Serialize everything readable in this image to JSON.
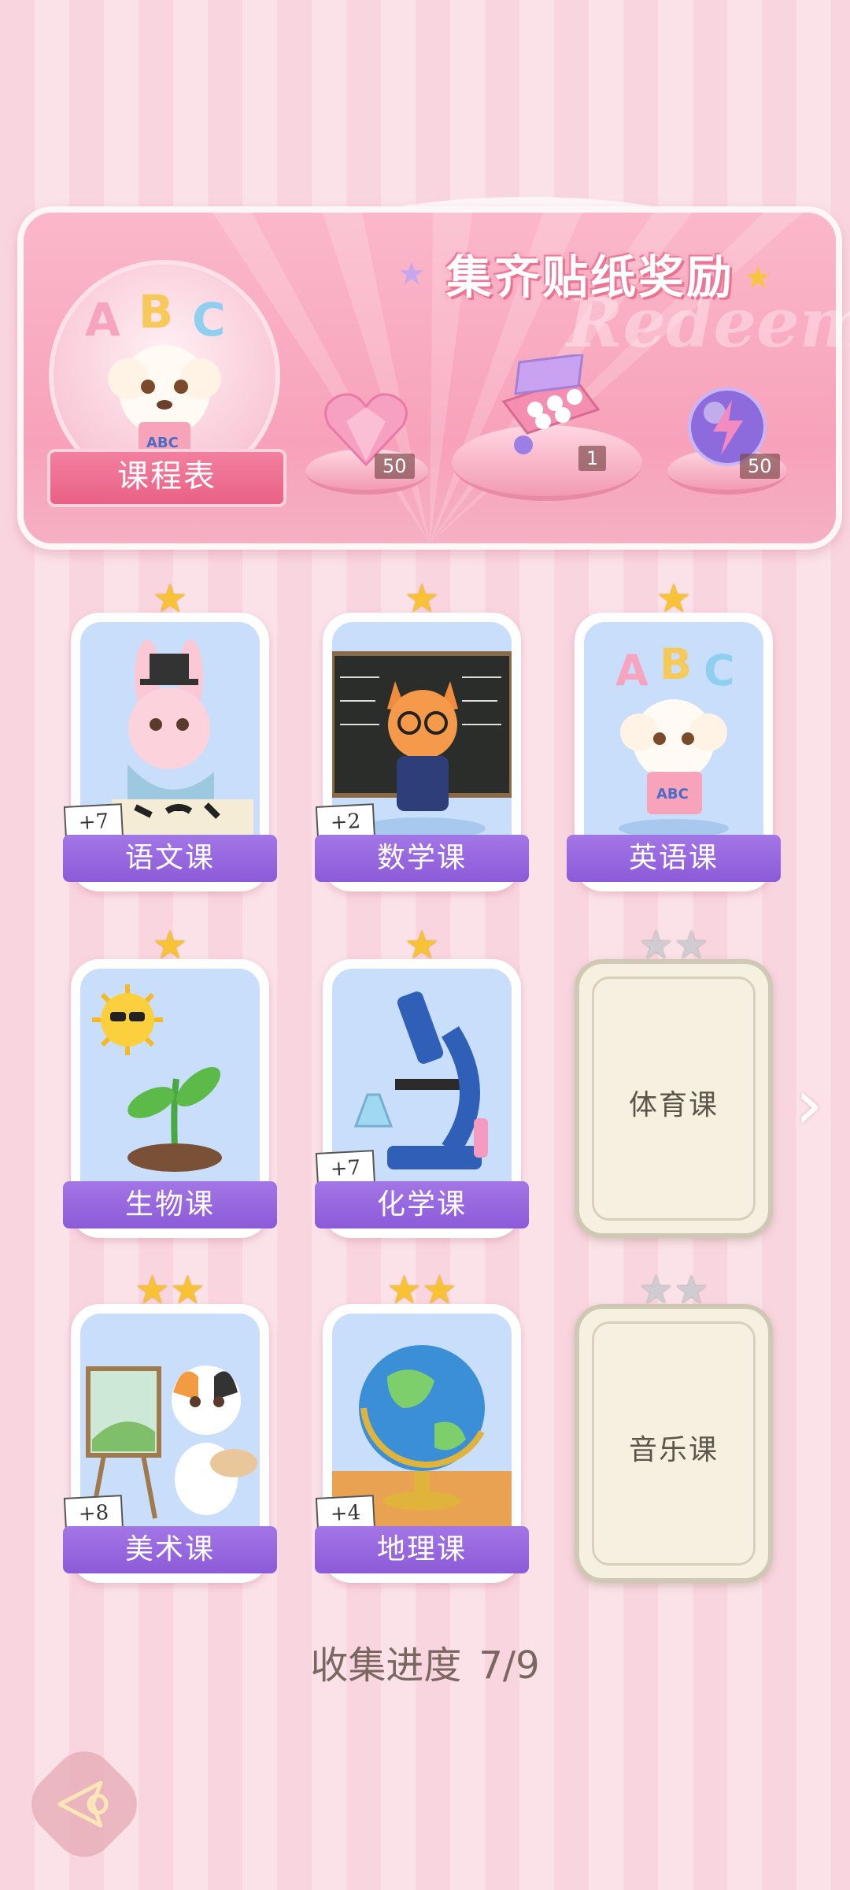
{
  "banner": {
    "title": "集齐贴纸奖励",
    "watermark": "Redeem",
    "schedule_label": "课程表",
    "rewards": [
      {
        "name": "heart-gem",
        "count": "50"
      },
      {
        "name": "gift-box",
        "count": "1"
      },
      {
        "name": "energy-orb",
        "count": "50"
      }
    ]
  },
  "courses": [
    {
      "label": "语文课",
      "stars": 1,
      "bonus": "+7",
      "unlocked": true
    },
    {
      "label": "数学课",
      "stars": 1,
      "bonus": "+2",
      "unlocked": true
    },
    {
      "label": "英语课",
      "stars": 1,
      "bonus": "",
      "unlocked": true
    },
    {
      "label": "生物课",
      "stars": 1,
      "bonus": "",
      "unlocked": true
    },
    {
      "label": "化学课",
      "stars": 1,
      "bonus": "+7",
      "unlocked": true
    },
    {
      "label": "体育课",
      "stars": 2,
      "bonus": "",
      "unlocked": false
    },
    {
      "label": "美术课",
      "stars": 2,
      "bonus": "+8",
      "unlocked": true
    },
    {
      "label": "地理课",
      "stars": 2,
      "bonus": "+4",
      "unlocked": true
    },
    {
      "label": "音乐课",
      "stars": 2,
      "bonus": "",
      "unlocked": false
    }
  ],
  "progress": {
    "label": "收集进度",
    "value": "7/9"
  },
  "colors": {
    "accent_purple": "#8b5bd8",
    "accent_pink": "#f37f9f",
    "star_gold": "#f7c233"
  }
}
